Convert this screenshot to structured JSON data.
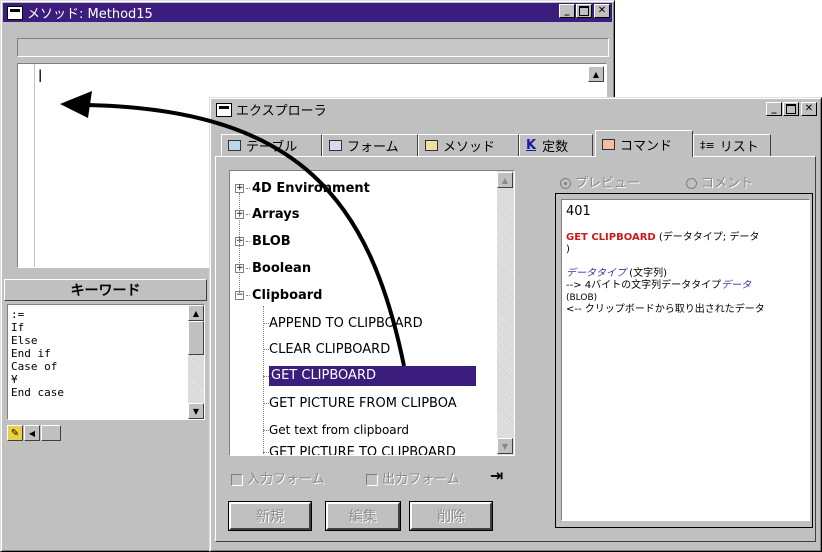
{
  "method_window": {
    "title": "メソッド: Method15",
    "editor_cursor": "|"
  },
  "keyword_panel": {
    "title": "キーワード",
    "items": [
      ":=",
      "If",
      "Else",
      "End if",
      "Case of",
      "¥",
      "End case"
    ]
  },
  "explorer": {
    "title": "エクスプローラ",
    "tabs": [
      {
        "label": "テーブル",
        "icon": "table-icon"
      },
      {
        "label": "フォーム",
        "icon": "form-icon"
      },
      {
        "label": "メソッド",
        "icon": "method-icon"
      },
      {
        "label": "定数",
        "icon": "constant-icon",
        "key": "K"
      },
      {
        "label": "コマンド",
        "icon": "command-icon",
        "selected": true
      },
      {
        "label": "リスト",
        "icon": "list-icon"
      }
    ],
    "tree": {
      "groups": [
        {
          "label": "4D Environment",
          "state": "collapsed"
        },
        {
          "label": "Arrays",
          "state": "collapsed"
        },
        {
          "label": "BLOB",
          "state": "collapsed"
        },
        {
          "label": "Boolean",
          "state": "collapsed"
        },
        {
          "label": "Clipboard",
          "state": "expanded"
        }
      ],
      "commands": [
        "APPEND TO CLIPBOARD",
        "CLEAR CLIPBOARD",
        "GET CLIPBOARD",
        "GET PICTURE FROM CLIPBOA",
        "Get text from clipboard",
        "GET PICTURE TO CLIPBOARD"
      ],
      "selected_command": "GET CLIPBOARD"
    },
    "checkboxes": {
      "input_form": "入力フォーム",
      "output_form": "出力フォーム"
    },
    "buttons": {
      "new": "新規",
      "edit": "編集",
      "delete": "削除"
    },
    "view_options": {
      "preview": "プレビュー",
      "comment": "コメント",
      "selected": "preview"
    },
    "preview": {
      "number": "401",
      "command_name": "GET CLIPBOARD",
      "syntax_rest": " (データタイプ; データ",
      "syntax_close": ")",
      "param1_name": "データタイプ",
      "param1_type": " (文字列)",
      "param1_desc_prefix": "--> 4バイトの文字列データタイプ",
      "param1_desc_link": "データ",
      "param1_desc_type": "(BLOB)",
      "param2_desc": "<-- クリップボードから取り出されたデータ"
    },
    "colors": {
      "selection": "#3a1d7c",
      "command_red": "#d01818",
      "link_purple": "#4a2c9e"
    }
  }
}
